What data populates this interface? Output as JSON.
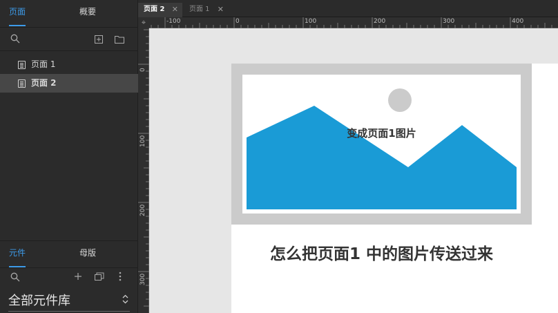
{
  "left_panel": {
    "top_tabs": [
      {
        "label": "页面",
        "active": true
      },
      {
        "label": "概要",
        "active": false
      }
    ],
    "pages": [
      {
        "label": "页面 1",
        "selected": false
      },
      {
        "label": "页面 2",
        "selected": true
      }
    ],
    "bottom_tabs": [
      {
        "label": "元件",
        "active": true
      },
      {
        "label": "母版",
        "active": false
      }
    ],
    "library_select": "全部元件库"
  },
  "doc_tabs": [
    {
      "label": "页面 2",
      "active": true
    },
    {
      "label": "页面 1",
      "active": false
    }
  ],
  "ruler": {
    "h_labels": [
      "-100",
      "0",
      "100",
      "200",
      "300",
      "400"
    ],
    "v_labels": [
      "0",
      "100",
      "200",
      "300"
    ]
  },
  "canvas": {
    "image_placeholder_text": "变成页面1图片",
    "heading_text": "怎么把页面1 中的图片传送过来"
  },
  "colors": {
    "accent": "#3d9be9",
    "mountain": "#1a9bd6",
    "placeholder_border": "#cbcbcb",
    "sun": "#cbcbcb"
  }
}
